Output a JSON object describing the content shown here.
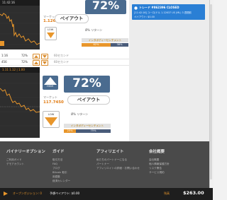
{
  "top_card": {
    "time": "11:42:16",
    "pct": "72%",
    "rate_label": "マーケット",
    "rate": "1.12637",
    "payout": "ペイアウト",
    "low_label": "LOW",
    "return_text": "Ø%  リターン",
    "sentiment_label": "インタボディーセンチメント",
    "sentiment_up": "62%",
    "sentiment_down": "38%"
  },
  "rows": [
    {
      "time": "1:16",
      "pct": "72%",
      "label": "60セカンド"
    },
    {
      "time": "456",
      "pct": "72%",
      "label": "60セカンド"
    },
    {
      "time": "1.11 1.12 | 1.00",
      "pct": "",
      "label": ""
    }
  ],
  "second_card": {
    "time_label": "11:42:16",
    "high_label": "HIGH",
    "pct": "72%",
    "rate_label": "マーケット",
    "rate": "117.7450",
    "payout": "ペイアウト",
    "low_label": "LOW",
    "return_text": "Ø%  リターン",
    "sentiment_label": "インタボディーセンチメント",
    "sentiment_up": "25%",
    "sentiment_down": "75%"
  },
  "notification": {
    "title": "トレード #862396 CLOSED",
    "detail": "[11:42:16] ユーロ/ドル 1.12637 US (ML) 3 週間前",
    "payout": "ペイアウト: $0.00"
  },
  "footer": {
    "columns": [
      {
        "title": "バイナリーオプション",
        "links": [
          "ご利用ガイド",
          "デモアカウント"
        ]
      },
      {
        "title": "ガイド",
        "links": [
          "取引方法",
          "FAQ",
          "ブログ",
          "Bitcoin 取引",
          "用語集",
          "経済カレンダー"
        ]
      },
      {
        "title": "アフィリエイト",
        "links": [
          "私たちのパートナーになる",
          "パートナー",
          "アフィリエイトの詳細・お問い合わせ"
        ]
      },
      {
        "title": "会社概要",
        "links": [
          "会社概要",
          "個人情報保護方針",
          "リスク警告",
          "サービス規約"
        ]
      }
    ]
  },
  "bottombar": {
    "open_positions": "オープンポジション: 0",
    "expected_payout": "予想ペイアウト: $0.00",
    "balance_label": "残高",
    "balance": "$263.00"
  },
  "colors": {
    "accent": "#e07a10",
    "pct_box": "#4a6b8f",
    "notify": "#2a7fd5",
    "footer": "#4a4a4a",
    "bottombar": "#1e1e1e"
  }
}
